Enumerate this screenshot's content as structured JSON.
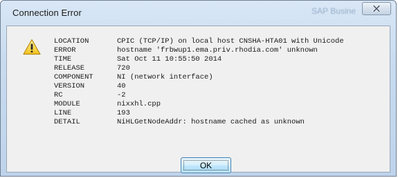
{
  "window": {
    "title": "Connection Error",
    "background_title": "SAP Busine",
    "close_icon": "close-icon"
  },
  "message": {
    "icon": "warning-icon",
    "lines": [
      {
        "key": "LOCATION",
        "value": "CPIC (TCP/IP) on local host CNSHA-HTA01 with Unicode"
      },
      {
        "key": "ERROR",
        "value": "hostname 'frbwup1.ema.priv.rhodia.com' unknown"
      },
      {
        "key": "TIME",
        "value": "Sat Oct 11 10:55:50 2014"
      },
      {
        "key": "RELEASE",
        "value": "720"
      },
      {
        "key": "COMPONENT",
        "value": "NI (network interface)"
      },
      {
        "key": "VERSION",
        "value": "40"
      },
      {
        "key": "RC",
        "value": "-2"
      },
      {
        "key": "MODULE",
        "value": "nixxhl.cpp"
      },
      {
        "key": "LINE",
        "value": "193"
      },
      {
        "key": "DETAIL",
        "value": "NiHLGetNodeAddr: hostname cached as unknown"
      }
    ]
  },
  "buttons": {
    "ok_label": "OK"
  },
  "colors": {
    "frame": "#c8dbef",
    "client": "#f0f0f0",
    "warning_fill": "#f5d23a",
    "ok_border": "#3c7fb1"
  }
}
